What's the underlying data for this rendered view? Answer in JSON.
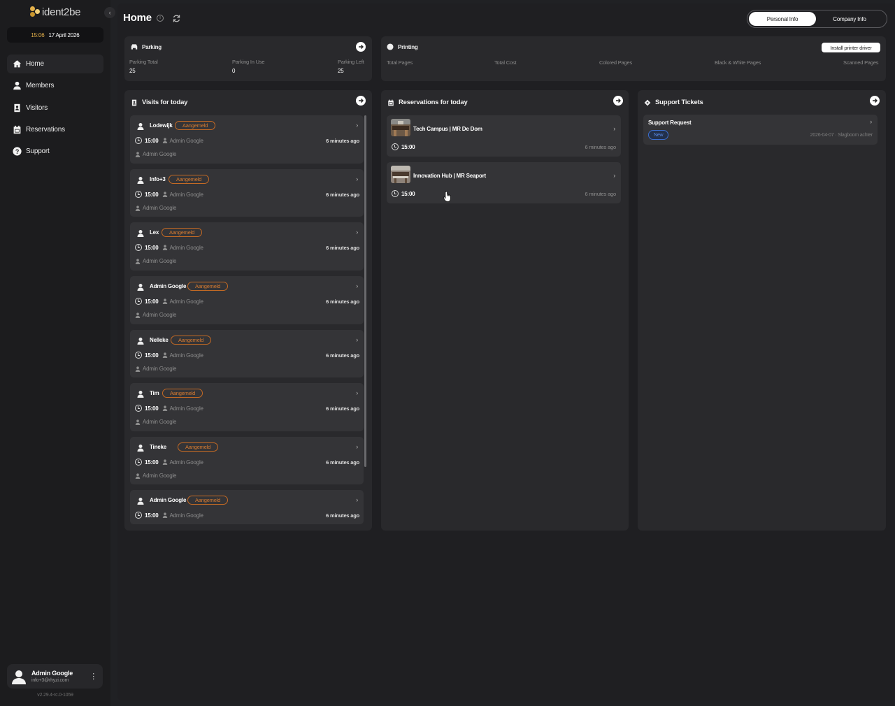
{
  "app": {
    "logo_text": "ident2be",
    "date_time": {
      "time": "15:06",
      "date": "17 April 2026"
    },
    "version": "v2.29.4-rc.0-1059"
  },
  "sidebar": {
    "items": [
      {
        "label": "Home",
        "icon": "home-icon",
        "active": true
      },
      {
        "label": "Members",
        "icon": "person-icon"
      },
      {
        "label": "Visitors",
        "icon": "badge-icon"
      },
      {
        "label": "Reservations",
        "icon": "calendar-icon"
      },
      {
        "label": "Support",
        "icon": "help-icon"
      }
    ],
    "user": {
      "name": "Admin Google",
      "email": "info+3@rhyzi.com"
    }
  },
  "header": {
    "title": "Home",
    "toggle": {
      "personal": "Personal Info",
      "company": "Company Info",
      "selected": "personal"
    }
  },
  "parking": {
    "title": "Parking",
    "stats": [
      {
        "label": "Parking Total",
        "value": "25"
      },
      {
        "label": "Parking In Use",
        "value": "0"
      },
      {
        "label": "Parking Left",
        "value": "25"
      }
    ]
  },
  "printing": {
    "title": "Printing",
    "install_label": "Install printer driver",
    "stats": [
      "Total Pages",
      "Total Cost",
      "Colored Pages",
      "Black & White Pages",
      "Scanned Pages"
    ]
  },
  "visits": {
    "title": "Visits for today",
    "items": [
      {
        "name": "Lodewijk",
        "status": "Aangemeld",
        "time": "15:00",
        "host": "Admin Google",
        "ago": "6 minutes ago",
        "by": "Admin Google"
      },
      {
        "name": "Info+3",
        "status": "Aangemeld",
        "time": "15:00",
        "host": "Admin Google",
        "ago": "6 minutes ago",
        "by": "Admin Google"
      },
      {
        "name": "Lex",
        "status": "Aangemeld",
        "time": "15:00",
        "host": "Admin Google",
        "ago": "6 minutes ago",
        "by": "Admin Google"
      },
      {
        "name": "Admin Google",
        "status": "Aangemeld",
        "time": "15:00",
        "host": "Admin Google",
        "ago": "6 minutes ago",
        "by": "Admin Google"
      },
      {
        "name": "Nelleke",
        "status": "Aangemeld",
        "time": "15:00",
        "host": "Admin Google",
        "ago": "6 minutes ago",
        "by": "Admin Google"
      },
      {
        "name": "Tim",
        "status": "Aangemeld",
        "time": "15:00",
        "host": "Admin Google",
        "ago": "6 minutes ago",
        "by": "Admin Google"
      },
      {
        "name": "Tineke",
        "status": "Aangemeld",
        "time": "15:00",
        "host": "Admin Google",
        "ago": "6 minutes ago",
        "by": "Admin Google"
      },
      {
        "name": "Admin Google",
        "status": "Aangemeld",
        "time": "15:00",
        "host": "Admin Google",
        "ago": "6 minutes ago"
      }
    ]
  },
  "reservations": {
    "title": "Reservations for today",
    "items": [
      {
        "name": "Tech Campus | MR De Dom",
        "time": "15:00",
        "ago": "6 minutes ago"
      },
      {
        "name": "Innovation Hub | MR Seaport",
        "time": "15:00",
        "ago": "6 minutes ago"
      }
    ]
  },
  "tickets": {
    "title": "Support Tickets",
    "items": [
      {
        "title": "Support Request",
        "status": "New",
        "meta": "2026-04-07 · Slagboom achter"
      }
    ]
  },
  "colors": {
    "accent": "#e5b14a",
    "badge_orange": "#d47a30",
    "badge_blue": "#3c6fd0"
  }
}
